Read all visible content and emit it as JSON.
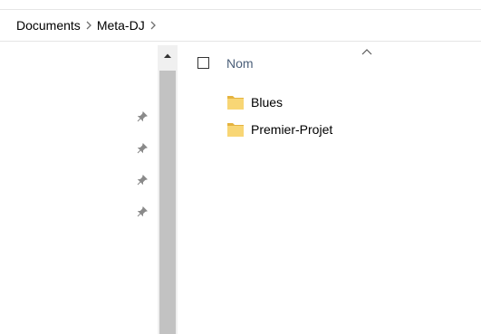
{
  "breadcrumb": {
    "items": [
      {
        "label": "Documents"
      },
      {
        "label": "Meta-DJ"
      }
    ]
  },
  "pinned": {
    "icons": [
      "pin-icon",
      "pin-icon",
      "pin-icon",
      "pin-icon"
    ]
  },
  "file_list": {
    "column_name": "Nom",
    "sort": "ascending",
    "items": [
      {
        "name": "Blues",
        "type": "folder"
      },
      {
        "name": "Premier-Projet",
        "type": "folder"
      }
    ]
  },
  "colors": {
    "header_text": "#4c607a",
    "folder_body": "#f8d675",
    "folder_tab": "#e5b33f",
    "scrollbar_track": "#f0f0f0",
    "scrollbar_thumb": "#c2c2c2"
  }
}
